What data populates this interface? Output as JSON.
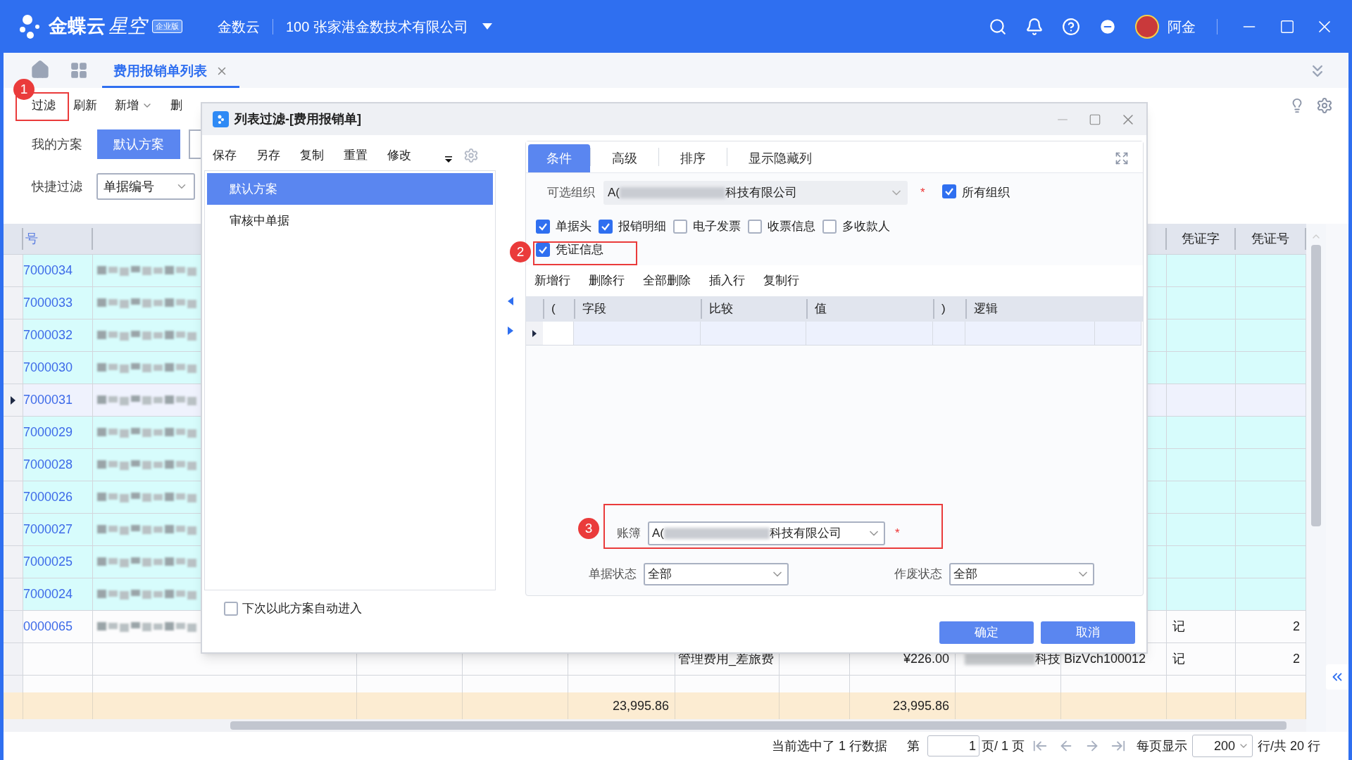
{
  "header": {
    "brand": "金蝶云",
    "product": "星空",
    "edition": "企业版",
    "cloud": "金数云",
    "org": "100  张家港金数技术有限公司",
    "user": "阿金"
  },
  "tabs": [
    {
      "label": "费用报销单列表",
      "selected": true
    }
  ],
  "toolbar": [
    "过滤",
    "刷新",
    "新增",
    "删"
  ],
  "schemes": {
    "label": "我的方案",
    "items": [
      {
        "label": "默认方案",
        "selected": true
      }
    ]
  },
  "quick_filter": {
    "label": "快捷过滤",
    "value": "单据编号"
  },
  "table": {
    "columns": [
      "号",
      "凭证字",
      "凭证号"
    ],
    "rows": [
      {
        "number": "7000034",
        "highlighted": true,
        "selected": false,
        "redacted": true
      },
      {
        "number": "7000033",
        "highlighted": true,
        "selected": false,
        "redacted": true
      },
      {
        "number": "7000032",
        "highlighted": true,
        "selected": false,
        "redacted": true
      },
      {
        "number": "7000030",
        "highlighted": true,
        "selected": false,
        "redacted": true
      },
      {
        "number": "7000031",
        "highlighted": false,
        "selected": true,
        "redacted": true
      },
      {
        "number": "7000029",
        "highlighted": true,
        "selected": false,
        "redacted": true
      },
      {
        "number": "7000028",
        "highlighted": true,
        "selected": false,
        "redacted": true
      },
      {
        "number": "7000026",
        "highlighted": true,
        "selected": false,
        "redacted": true
      },
      {
        "number": "7000027",
        "highlighted": true,
        "selected": false,
        "redacted": true
      },
      {
        "number": "7000025",
        "highlighted": true,
        "selected": false,
        "redacted": true
      },
      {
        "number": "7000024",
        "highlighted": true,
        "selected": false,
        "redacted": true
      },
      {
        "number": "0000065",
        "highlighted": false,
        "selected": false,
        "redacted": true,
        "voucher_word": "记",
        "voucher_no": "2"
      },
      {
        "highlighted": false,
        "selected": false,
        "redacted": false,
        "expense_item": "管理费用_差旅费",
        "amount": "¥226.00",
        "org_tail": "科技",
        "voucher_code": "BizVch100012",
        "voucher_word": "记",
        "voucher_no": "2"
      },
      {
        "highlighted": false,
        "selected": false,
        "redacted": false
      }
    ],
    "totals": [
      "23,995.86",
      "23,995.86"
    ]
  },
  "dialog": {
    "title": "列表过滤-[费用报销单]",
    "scheme_toolbar": [
      "保存",
      "另存",
      "复制",
      "重置",
      "修改"
    ],
    "schemes": [
      {
        "label": "默认方案",
        "selected": true
      },
      {
        "label": "审核中单据",
        "selected": false
      }
    ],
    "auto_enter": {
      "label": "下次以此方案自动进入",
      "checked": false
    },
    "tabs": [
      {
        "label": "条件",
        "selected": true
      },
      {
        "label": "高级",
        "selected": false
      },
      {
        "label": "排序",
        "selected": false
      },
      {
        "label": "显示隐藏列",
        "selected": false
      }
    ],
    "org": {
      "label": "可选组织",
      "value_start": "A(",
      "value_end": "科技有限公司",
      "required_mark": "*"
    },
    "all_orgs": {
      "label": "所有组织",
      "checked": true
    },
    "sections": [
      {
        "label": "单据头",
        "checked": true
      },
      {
        "label": "报销明细",
        "checked": true
      },
      {
        "label": "电子发票",
        "checked": false
      },
      {
        "label": "收票信息",
        "checked": false
      },
      {
        "label": "多收款人",
        "checked": false
      },
      {
        "label": "凭证信息",
        "checked": true
      }
    ],
    "grid_toolbar": [
      "新增行",
      "删除行",
      "全部删除",
      "插入行",
      "复制行"
    ],
    "grid_columns": [
      "(",
      "字段",
      "比较",
      "值",
      ")",
      "逻辑"
    ],
    "ledger": {
      "label": "账簿",
      "value_start": "A(",
      "value_end": "科技有限公司",
      "required_mark": "*"
    },
    "status": {
      "label": "单据状态",
      "value": "全部"
    },
    "void_status": {
      "label": "作废状态",
      "value": "全部"
    },
    "buttons": [
      "确定",
      "取消"
    ]
  },
  "annotations": [
    "1",
    "2",
    "3"
  ],
  "status_bar": {
    "selection_info": "当前选中了 1 行数据",
    "page_label": "第",
    "page": "1",
    "page_of": "页/ 1 页",
    "per_page_label": "每页显示",
    "per_page": "200",
    "total": "行/共 20 行"
  }
}
